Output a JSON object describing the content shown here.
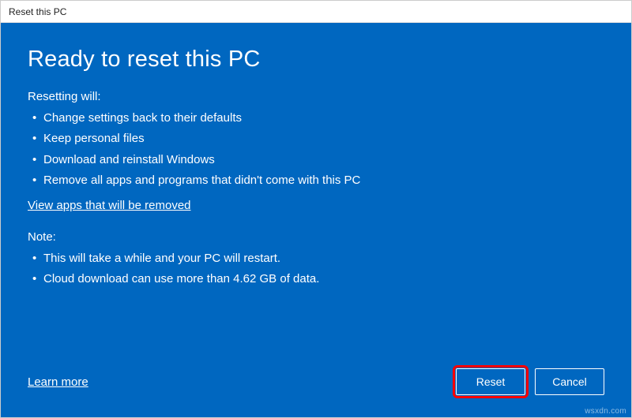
{
  "window": {
    "title": "Reset this PC"
  },
  "heading": "Ready to reset this PC",
  "resetting": {
    "label": "Resetting will:",
    "items": [
      "Change settings back to their defaults",
      "Keep personal files",
      "Download and reinstall Windows",
      "Remove all apps and programs that didn't come with this PC"
    ]
  },
  "view_apps_link": "View apps that will be removed",
  "note": {
    "label": "Note:",
    "items": [
      "This will take a while and your PC will restart.",
      "Cloud download can use more than 4.62 GB of data."
    ]
  },
  "learn_more_link": "Learn more",
  "buttons": {
    "reset": "Reset",
    "cancel": "Cancel"
  },
  "watermark": "wsxdn.com"
}
